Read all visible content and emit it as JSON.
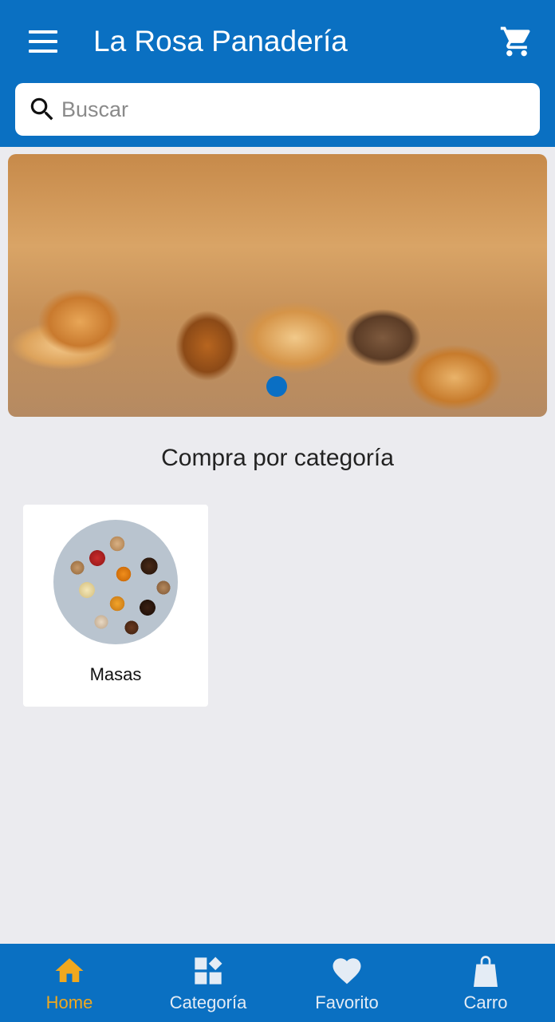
{
  "header": {
    "title": "La Rosa Panadería",
    "menu_icon": "menu-icon",
    "cart_icon": "shopping-cart-icon",
    "bg_color": "#0a70c2"
  },
  "search": {
    "placeholder": "Buscar",
    "value": ""
  },
  "banner": {
    "slide_count": 1,
    "active_slide": 1
  },
  "categories_section": {
    "title": "Compra por categoría",
    "items": [
      {
        "label": "Masas"
      }
    ]
  },
  "bottom_nav": {
    "active_color": "#f0a81e",
    "items": [
      {
        "label": "Home",
        "icon": "home-icon",
        "active": true
      },
      {
        "label": "Categoría",
        "icon": "category-icon",
        "active": false
      },
      {
        "label": "Favorito",
        "icon": "heart-icon",
        "active": false
      },
      {
        "label": "Carro",
        "icon": "shopping-bag-icon",
        "active": false
      }
    ]
  }
}
